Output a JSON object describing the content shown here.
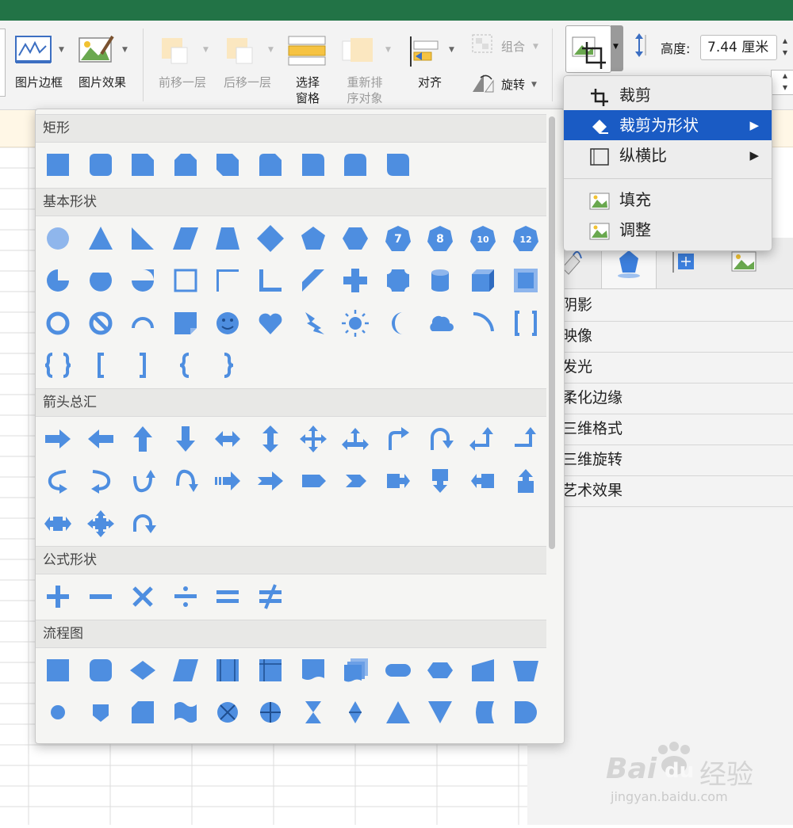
{
  "ribbon": {
    "items": [
      {
        "label": "图片边框"
      },
      {
        "label": "图片效果"
      },
      {
        "label": "前移一层"
      },
      {
        "label": "后移一层"
      },
      {
        "label": "选择\n窗格"
      },
      {
        "label": "重新排\n序对象"
      },
      {
        "label": "对齐"
      }
    ],
    "group_label": "组合",
    "rotate_label": "旋转",
    "height_label": "高度:",
    "height_value": "7.44 厘米"
  },
  "crop_menu": {
    "items": [
      {
        "label": "裁剪",
        "icon": "crop-icon"
      },
      {
        "label": "裁剪为形状",
        "icon": "crop-to-shape-icon",
        "submenu": "▶",
        "active": true
      },
      {
        "label": "纵横比",
        "icon": "aspect-ratio-icon",
        "submenu": "▶"
      },
      {
        "label": "填充",
        "icon": "fill-image-icon"
      },
      {
        "label": "调整",
        "icon": "fit-image-icon"
      }
    ]
  },
  "format_pane": {
    "rows": [
      "阴影",
      "映像",
      "发光",
      "柔化边缘",
      "三维格式",
      "三维旋转",
      "艺术效果"
    ]
  },
  "gallery": {
    "sections": [
      {
        "title": "矩形",
        "rows": [
          [
            "rect",
            "round-rect",
            "snip-1",
            "snip-2",
            "snip-diag",
            "snip-round",
            "round-1",
            "round-2",
            "round-diag"
          ]
        ]
      },
      {
        "title": "基本形状",
        "rows": [
          [
            "oval",
            "triangle",
            "right-triangle",
            "parallelogram",
            "trapezoid",
            "diamond",
            "pentagon",
            "hexagon",
            "heptagon-7",
            "octagon-8",
            "decagon-10",
            "dodecagon-12"
          ],
          [
            "pie",
            "chord",
            "teardrop",
            "frame",
            "half-frame",
            "l-shape",
            "diagonal-stripe",
            "cross",
            "plaque",
            "can",
            "cube",
            "bevel"
          ],
          [
            "donut",
            "no-symbol",
            "block-arc",
            "folded-corner",
            "smiley",
            "heart",
            "lightning",
            "sun",
            "moon",
            "cloud",
            "arc",
            "double-bracket"
          ],
          [
            "double-brace",
            "left-bracket",
            "right-bracket",
            "left-brace",
            "right-brace"
          ]
        ]
      },
      {
        "title": "箭头总汇",
        "rows": [
          [
            "arrow-right",
            "arrow-left",
            "arrow-up",
            "arrow-down",
            "arrow-left-right",
            "arrow-up-down",
            "arrow-quad",
            "arrow-left-right-up",
            "arrow-bent",
            "arrow-u-turn",
            "arrow-left-up",
            "arrow-bent-up"
          ],
          [
            "arrow-curved-right",
            "arrow-curved-left",
            "arrow-curved-up",
            "arrow-curved-down",
            "arrow-striped",
            "arrow-notched",
            "arrow-pentagon",
            "arrow-chevron",
            "callout-right",
            "callout-down",
            "callout-left",
            "callout-up"
          ],
          [
            "callout-left-right",
            "callout-quad",
            "arrow-circular"
          ]
        ]
      },
      {
        "title": "公式形状",
        "rows": [
          [
            "plus",
            "minus",
            "multiply",
            "divide",
            "equal",
            "not-equal"
          ]
        ]
      },
      {
        "title": "流程图",
        "rows": [
          [
            "process",
            "alt-process",
            "decision",
            "data",
            "predefined",
            "internal-storage",
            "document",
            "multidocument",
            "terminator",
            "preparation",
            "manual-input",
            "manual-operation"
          ],
          [
            "connector",
            "offpage",
            "card",
            "punched-tape",
            "summing-junction",
            "or",
            "collate",
            "sort",
            "extract",
            "merge",
            "stored-data",
            "delay"
          ]
        ]
      }
    ]
  },
  "watermark": {
    "brand": "Bai",
    "brand2": "du",
    "cn": "经验",
    "url": "jingyan.baidu.com"
  },
  "colors": {
    "shape": "#4e8ee0",
    "accent": "#1a5bc4",
    "titlebar": "#227346"
  }
}
